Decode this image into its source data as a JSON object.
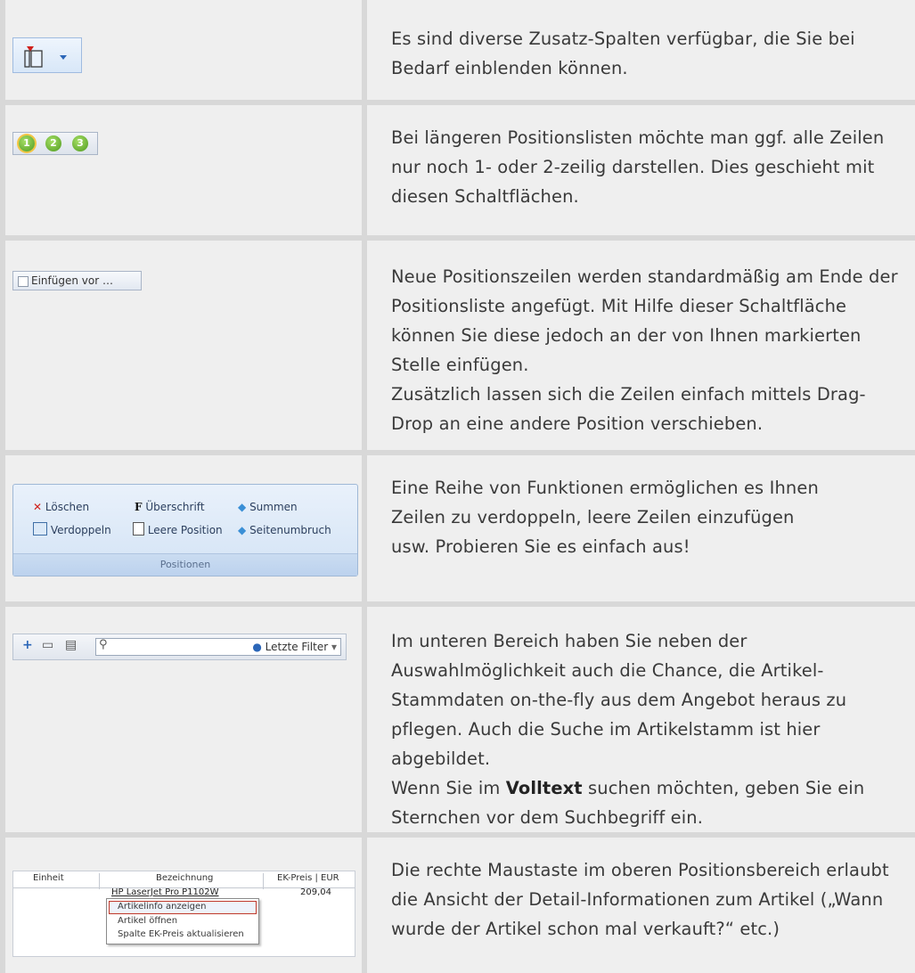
{
  "rows": [
    {
      "text": "Es sind diverse Zusatz-Spalten verfügbar, die Sie bei Bedarf einblenden können."
    },
    {
      "text": "Bei längeren Positionslisten möchte man ggf. alle Zeilen nur noch 1- oder 2-zeilig darstellen. Dies geschieht mit diesen Schaltflächen.",
      "buttons": [
        "1",
        "2",
        "3"
      ]
    },
    {
      "button_label": "Einfügen vor …",
      "text_1": "Neue Positionszeilen werden standardmäßig am Ende der Positionsliste angefügt. Mit Hilfe dieser Schaltfläche können Sie diese jedoch an der von Ihnen markierten Stelle einfügen.",
      "text_2": "Zusätzlich lassen sich die Zeilen einfach mittels Drag-Drop an eine andere Position verschieben."
    },
    {
      "ribbon": {
        "loeschen": "Löschen",
        "ueberschrift": "Überschrift",
        "summen": "Summen",
        "verdoppeln": "Verdoppeln",
        "leere_position": "Leere Position",
        "seitenumbruch": "Seitenumbruch",
        "group": "Positionen",
        "bold_f": "F"
      },
      "text": "Eine Reihe von Funktionen ermöglichen es Ihnen Zeilen zu verdoppeln, leere Zeilen einzufügen usw. Probieren Sie es einfach aus!"
    },
    {
      "toolbar": {
        "filter_label": "Letzte Filter"
      },
      "text_1": "Im unteren Bereich haben Sie neben der Auswahlmöglichkeit auch die Chance, die Artikel-Stammdaten on-the-fly aus dem Angebot heraus zu pflegen. Auch die Suche im Artikelstamm ist hier abgebildet.",
      "text_2a": "Wenn Sie im ",
      "text_2b": "Volltext",
      "text_2c": " suchen möchten, geben Sie ein Sternchen vor dem Suchbegriff ein."
    },
    {
      "table": {
        "col1": "Einheit",
        "col2": "Bezeichnung",
        "col3": "EK-Preis | EUR",
        "item": "HP LaserJet Pro P1102W",
        "price": "209,04"
      },
      "menu": [
        "Artikelinfo anzeigen",
        "Artikel öffnen",
        "Spalte EK-Preis aktualisieren"
      ],
      "text": "Die rechte Maustaste im oberen Positionsbereich erlaubt die Ansicht der Detail-Informationen zum Artikel („Wann wurde der Artikel schon mal verkauft?“ etc.)"
    }
  ]
}
